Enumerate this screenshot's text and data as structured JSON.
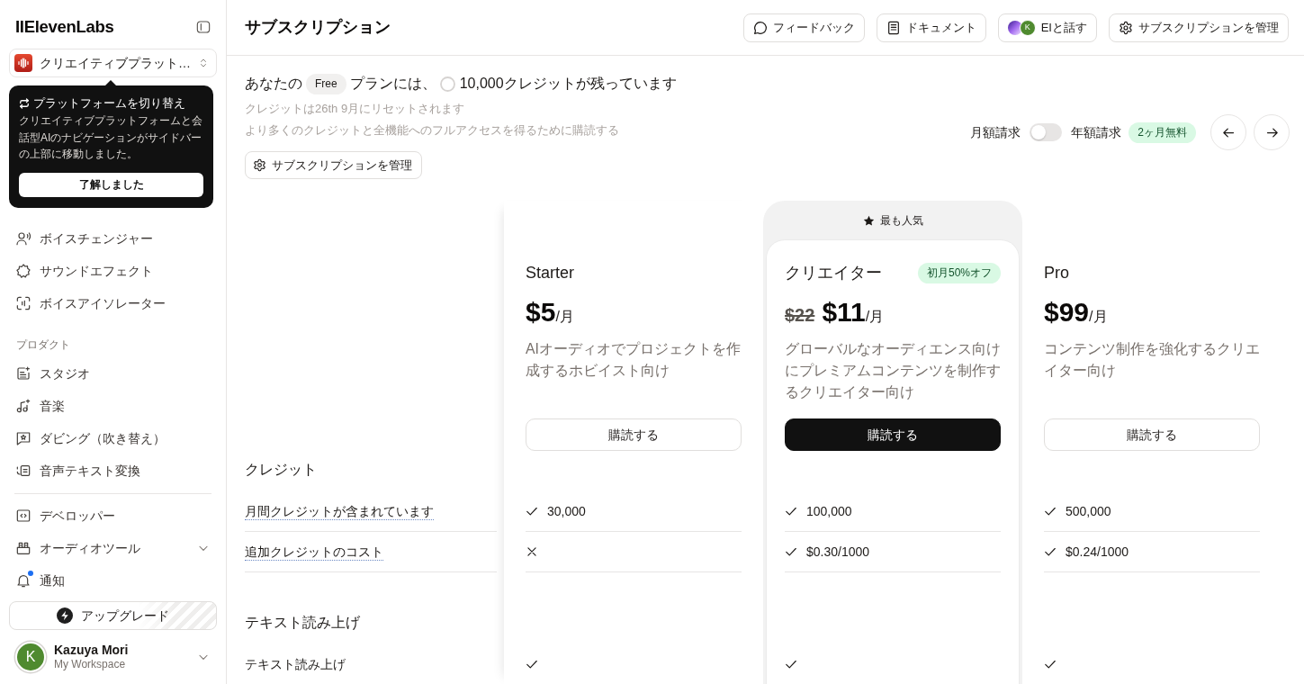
{
  "sidebar": {
    "logo": "IIElevenLabs",
    "platform_selector": {
      "label": "クリエイティブプラット…"
    },
    "popover": {
      "title": "プラットフォームを切り替え",
      "body": "クリエイティブプラットフォームと会話型AIのナビゲーションがサイドバーの上部に移動しました。",
      "button": "了解しました"
    },
    "nav_groups": [
      {
        "items": [
          {
            "label": "ボイスチェンジャー",
            "kind": "link",
            "has_dot": false
          },
          {
            "label": "サウンドエフェクト",
            "kind": "link",
            "has_dot": false
          },
          {
            "label": "ボイスアイソレーター",
            "kind": "link",
            "has_dot": false
          }
        ]
      },
      {
        "heading": "プロダクト",
        "items": [
          {
            "label": "スタジオ",
            "kind": "link",
            "has_dot": false
          },
          {
            "label": "音楽",
            "kind": "link",
            "has_dot": false
          },
          {
            "label": "ダビング（吹き替え）",
            "kind": "link",
            "has_dot": false
          },
          {
            "label": "音声テキスト変換",
            "kind": "link",
            "has_dot": false
          }
        ]
      },
      {
        "items": [
          {
            "label": "デベロッパー",
            "kind": "link",
            "has_dot": false
          },
          {
            "label": "オーディオツール",
            "kind": "submenu",
            "expanded": false,
            "has_dot": false
          },
          {
            "label": "通知",
            "kind": "link",
            "has_dot": true
          }
        ]
      }
    ],
    "upgrade_button": "アップグレード",
    "user": {
      "avatar_initial": "K",
      "name": "Kazuya Mori",
      "workspace": "My Workspace"
    }
  },
  "header": {
    "title": "サブスクリプション",
    "buttons": [
      {
        "label": "フィードバック"
      },
      {
        "label": "ドキュメント"
      },
      {
        "label": "EIと話す",
        "avatar_initial": "K"
      },
      {
        "label": "サブスクリプションを管理"
      }
    ]
  },
  "plan_summary": {
    "prefix": "あなたの",
    "plan_name": "Free",
    "middle": "プランには、",
    "credits_text": "10,000クレジットが残っています",
    "reset_note": "クレジットは26th 9月にリセットされます",
    "upsell_note": "より多くのクレジットと全機能へのフルアクセスを得るために購読する",
    "manage_button": "サブスクリプションを管理"
  },
  "billing": {
    "monthly_label": "月額請求",
    "annual_label": "年額請求",
    "annual": false,
    "discount_badge": "2ヶ月無料"
  },
  "plans": [
    {
      "name": "Starter",
      "featured": false,
      "price": "$5",
      "period": "/月",
      "description": "AIオーディオでプロジェクトを作成するホビイスト向け",
      "button": "購読する"
    },
    {
      "name": "クリエイター",
      "featured": true,
      "popular_label": "最も人気",
      "badge": "初月50%オフ",
      "old_price": "$22",
      "price": "$11",
      "period": "/月",
      "description": "グローバルなオーディエンス向けにプレミアムコンテンツを制作するクリエイター向け",
      "button": "購読する"
    },
    {
      "name": "Pro",
      "featured": false,
      "price": "$99",
      "period": "/月",
      "description": "コンテンツ制作を強化するクリエイター向け",
      "button": "購読する"
    }
  ],
  "feature_sections": [
    {
      "title": "クレジット",
      "rows": [
        {
          "label": "月間クレジットが含まれています",
          "has_tooltip": true,
          "cells": [
            {
              "kind": "check",
              "text": "30,000"
            },
            {
              "kind": "check",
              "text": "100,000"
            },
            {
              "kind": "check",
              "text": "500,000"
            }
          ]
        },
        {
          "label": "追加クレジットのコスト",
          "has_tooltip": true,
          "cells": [
            {
              "kind": "cross"
            },
            {
              "kind": "check",
              "text": "$0.30/1000"
            },
            {
              "kind": "check",
              "text": "$0.24/1000"
            }
          ]
        }
      ]
    },
    {
      "title": "テキスト読み上げ",
      "rows": [
        {
          "label": "テキスト読み上げ",
          "has_tooltip": false,
          "cells": [
            {
              "kind": "check"
            },
            {
              "kind": "check"
            },
            {
              "kind": "check"
            }
          ]
        }
      ]
    }
  ]
}
